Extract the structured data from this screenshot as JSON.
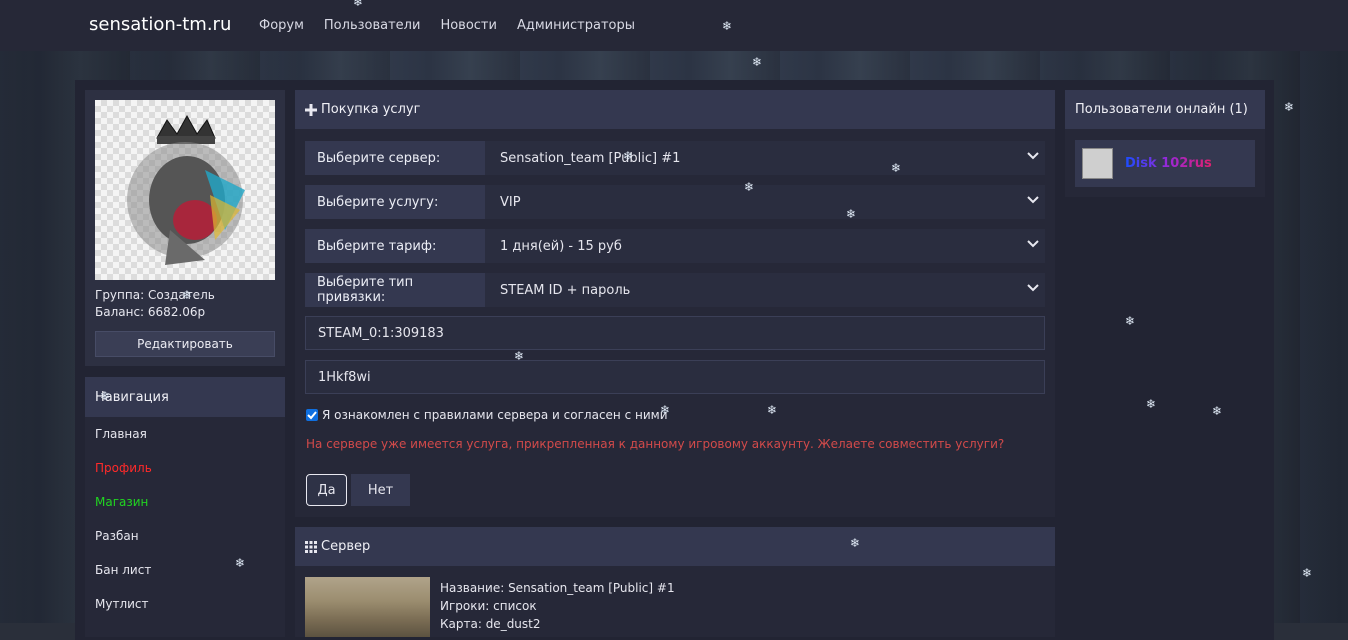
{
  "site": {
    "brand": "sensation-tm.ru",
    "nav": [
      "Форум",
      "Пользователи",
      "Новости",
      "Администраторы"
    ]
  },
  "profile": {
    "group": "Группа: Создатель",
    "balance": "Баланс: 6682.06р",
    "edit_label": "Редактировать"
  },
  "navigation": {
    "title": "Навигация",
    "items": [
      {
        "label": "Главная",
        "color": "#e6e6ee"
      },
      {
        "label": "Профиль",
        "color": "#ff2a2a"
      },
      {
        "label": "Магазин",
        "color": "#21d421"
      },
      {
        "label": "Разбан",
        "color": "#e6e6ee"
      },
      {
        "label": "Бан лист",
        "color": "#e6e6ee"
      },
      {
        "label": "Мутлист",
        "color": "#e6e6ee"
      }
    ]
  },
  "purchase": {
    "title": "Покупка услуг",
    "server_label": "Выберите сервер:",
    "server_value": "Sensation_team [Public] #1",
    "service_label": "Выберите услугу:",
    "service_value": "VIP",
    "tariff_label": "Выберите тариф:",
    "tariff_value": "1 дня(ей) - 15 руб",
    "bind_label": "Выберите тип привязки:",
    "bind_value": "STEAM ID + пароль",
    "steam_id": "STEAM_0:1:309183",
    "password": "1Hkf8wi",
    "agree_text": "Я ознакомлен с правилами сервера и согласен с ними",
    "warning": "На сервере уже имеется услуга, прикрепленная к данному игровому аккаунту. Желаете совместить услуги?",
    "yes_label": "Да",
    "no_label": "Нет"
  },
  "server": {
    "title": "Сервер",
    "name": "Название:  Sensation_team [Public] #1",
    "players": "Игроки:  список",
    "map": "Карта:  de_dust2"
  },
  "online": {
    "title": "Пользователи онлайн (1)",
    "user": "Disk 102rus"
  },
  "icons": {
    "plus": "plus-icon",
    "grid": "grid-icon",
    "chevron": "chevron-down-icon",
    "check": "check-icon",
    "snowflake": "snowflake-icon"
  }
}
